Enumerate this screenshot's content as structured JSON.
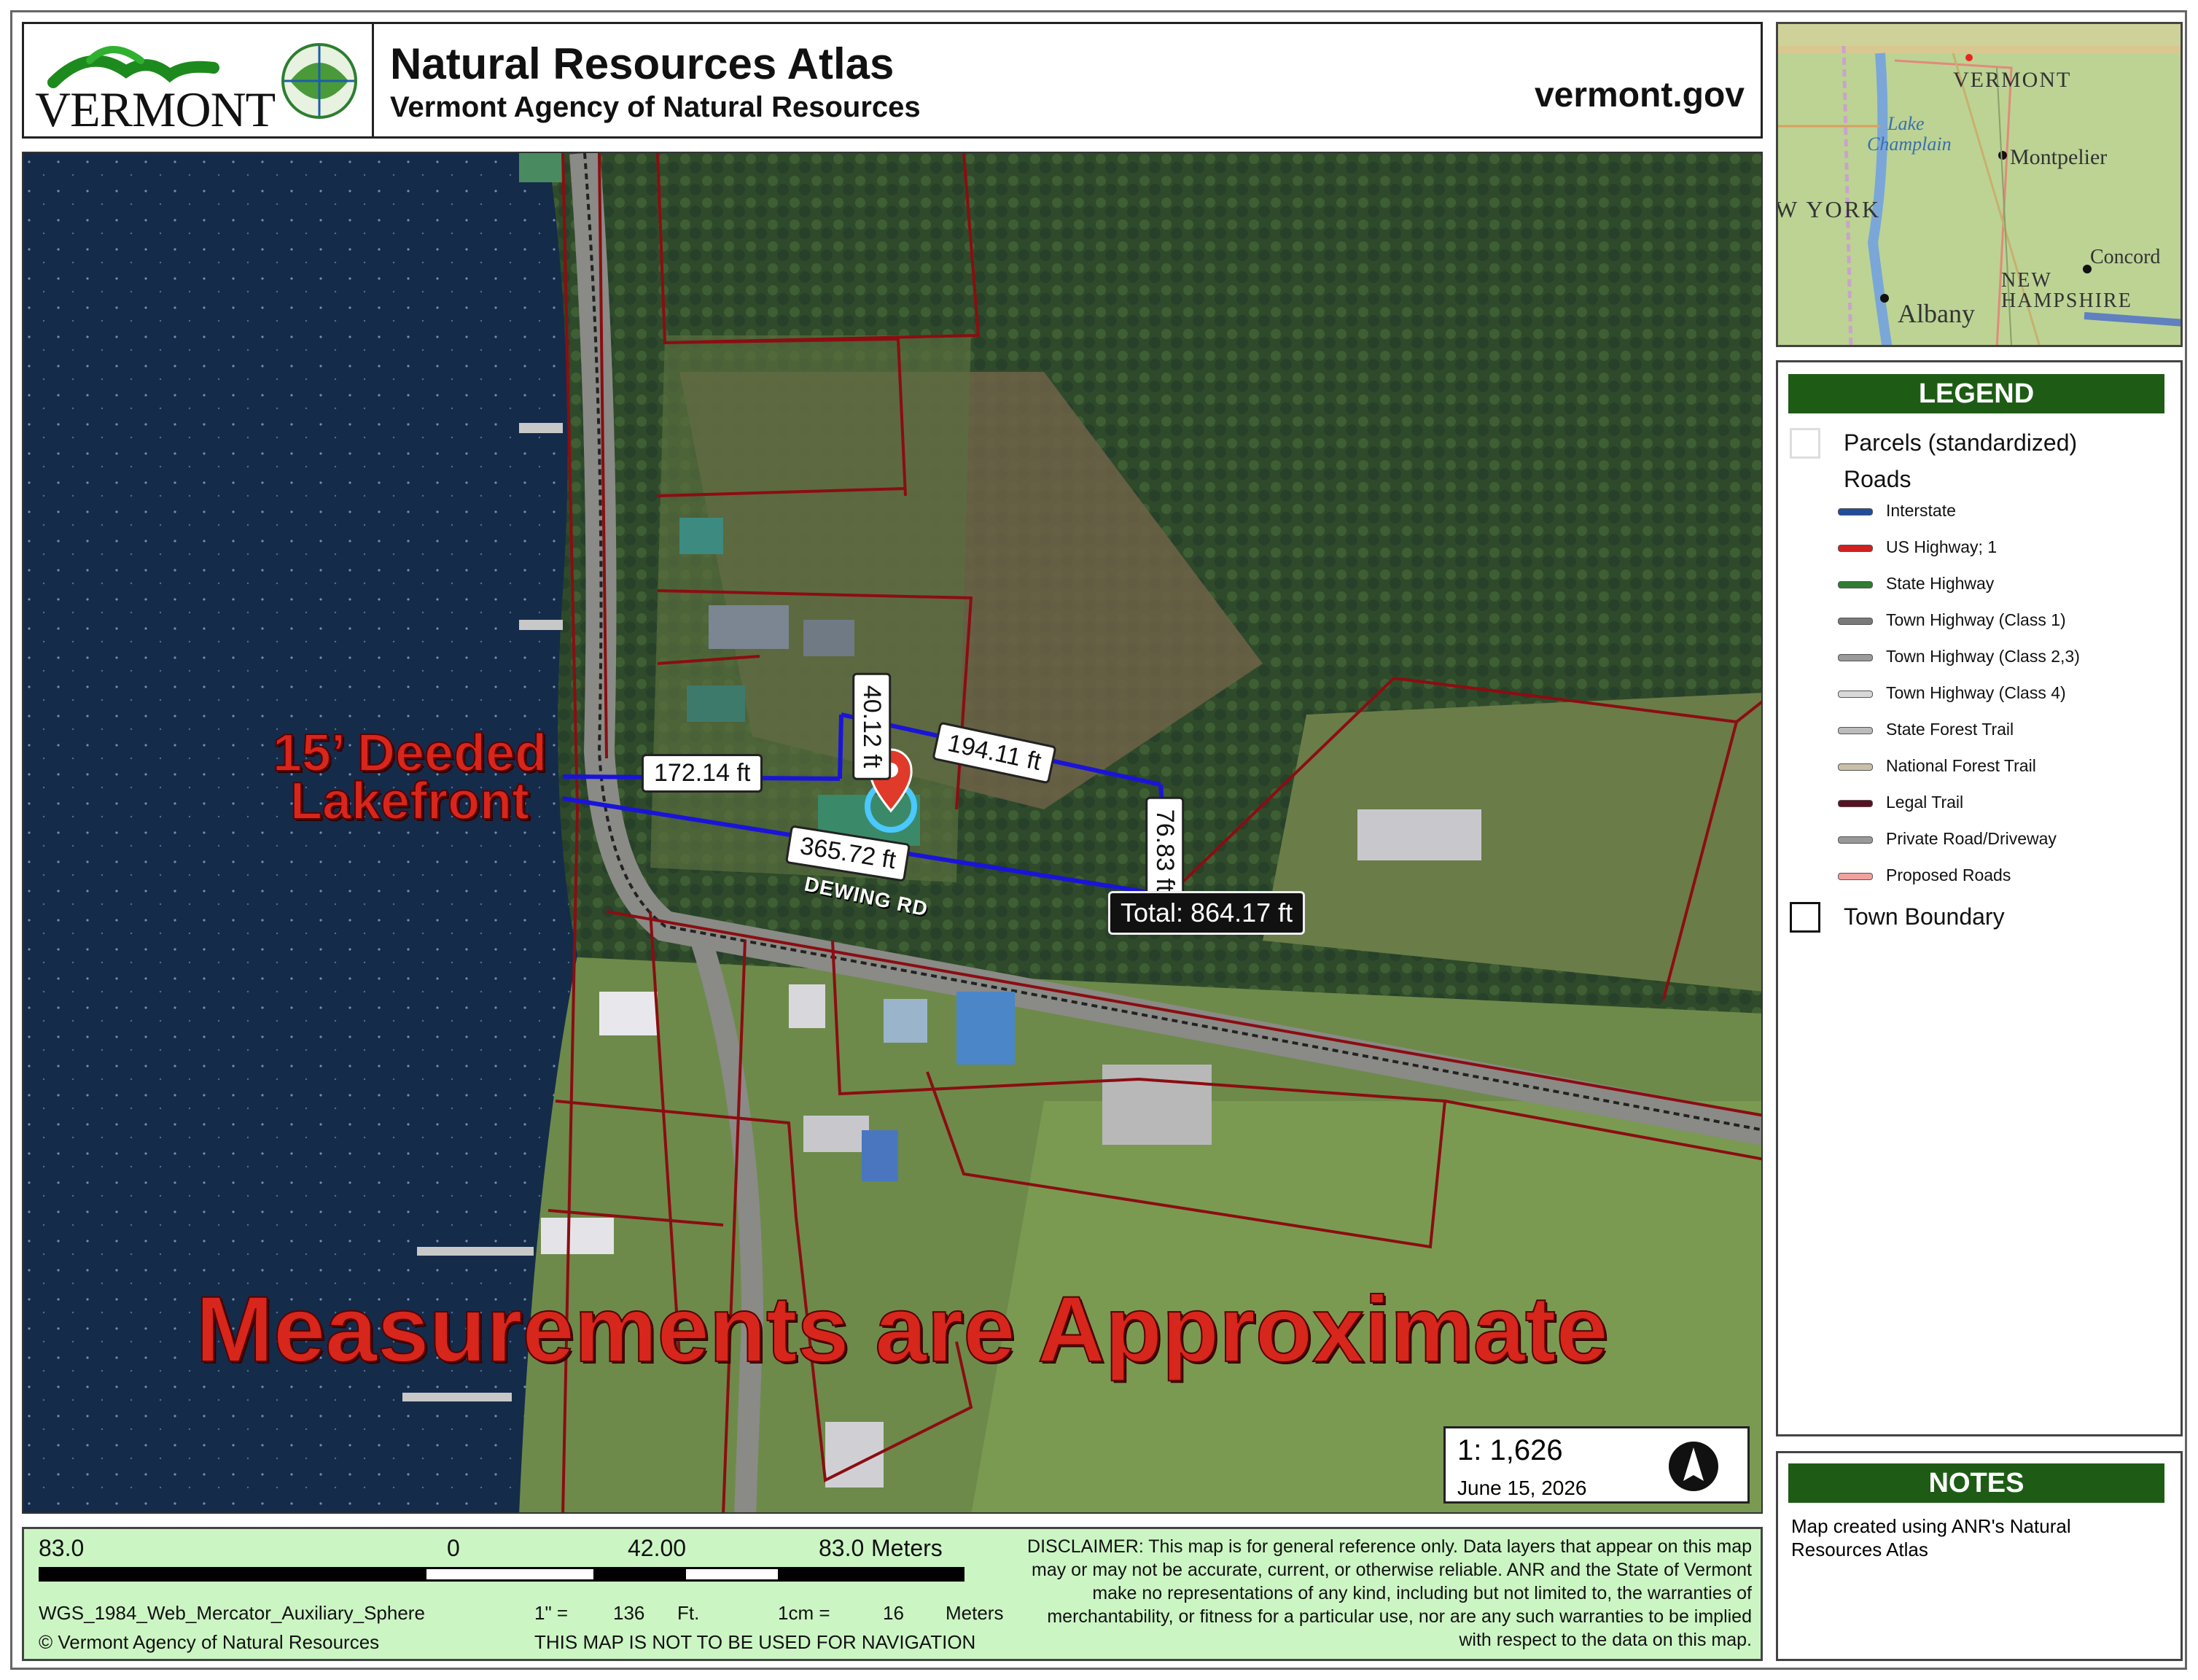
{
  "header": {
    "logo_word": "VERMONT",
    "title": "Natural Resources Atlas",
    "subtitle": "Vermont Agency of Natural Resources",
    "url": "vermont.gov"
  },
  "map": {
    "measurements": {
      "seg1": "172.14 ft",
      "seg2": "40.12 ft",
      "seg3": "194.11 ft",
      "seg4": "76.83 ft",
      "seg5": "365.72 ft",
      "total": "Total: 864.17 ft"
    },
    "road_name": "DEWING RD",
    "annotation_lakefront_line1": "15’ Deeded",
    "annotation_lakefront_line2": "Lakefront",
    "annotation_approx": "Measurements are Approximate",
    "scale_ratio": "1:  1,626",
    "date": "June 15, 2026"
  },
  "overview": {
    "labels": {
      "vermont": "VERMONT",
      "lake": "Lake",
      "champlain": "Champlain",
      "montpelier": "Montpelier",
      "new_york": "W YORK",
      "concord": "Concord",
      "new": "NEW",
      "new_hampshire": "HAMPSHIRE",
      "albany": "Albany"
    }
  },
  "legend": {
    "title": "LEGEND",
    "parcels": "Parcels (standardized)",
    "roads": "Roads",
    "items": [
      {
        "label": "Interstate",
        "color": "#1f4e9c"
      },
      {
        "label": "US Highway; 1",
        "color": "#d21f1f"
      },
      {
        "label": "State Highway",
        "color": "#2e7d32"
      },
      {
        "label": "Town Highway (Class 1)",
        "color": "#7a7a7a"
      },
      {
        "label": "Town Highway (Class 2,3)",
        "color": "#9a9a9a"
      },
      {
        "label": "Town Highway (Class 4)",
        "color": "#d8d8d8"
      },
      {
        "label": "State Forest Trail",
        "color": "#bbbbbb"
      },
      {
        "label": "National Forest Trail",
        "color": "#c8c0a8"
      },
      {
        "label": "Legal Trail",
        "color": "#5a1020"
      },
      {
        "label": "Private Road/Driveway",
        "color": "#999999"
      },
      {
        "label": "Proposed Roads",
        "color": "#f2a0a0"
      }
    ],
    "town_boundary": "Town Boundary"
  },
  "notes": {
    "title": "NOTES",
    "text": "Map created using ANR's Natural Resources Atlas"
  },
  "footer": {
    "scale_left": "83.0",
    "scale_zero": "0",
    "scale_mid": "42.00",
    "scale_right": "83.0",
    "scale_unit": "Meters",
    "projection": "WGS_1984_Web_Mercator_Auxiliary_Sphere",
    "copyright": "© Vermont Agency of Natural Resources",
    "inch_label": "1\" =",
    "inch_value": "136",
    "inch_unit": "Ft.",
    "cm_label": "1cm =",
    "cm_value": "16",
    "cm_unit": "Meters",
    "navigation_warning": "THIS MAP IS NOT TO BE USED FOR NAVIGATION",
    "disclaimer": "DISCLAIMER: This map is for general reference only. Data layers that appear on this map may or may not be accurate, current, or otherwise reliable. ANR and the State of Vermont make no representations of any kind, including but not limited to, the warranties of merchantability, or fitness for a particular use, nor are any such warranties to be implied with respect to the data on this map."
  }
}
